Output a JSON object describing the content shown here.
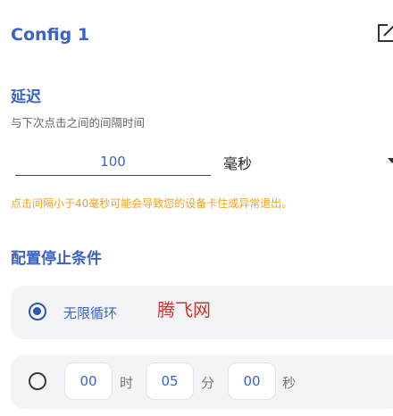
{
  "header": {
    "title": "Config 1",
    "edit_icon": "edit-icon"
  },
  "delay": {
    "title": "延迟",
    "subtitle": "与下次点击之间的间隔时间",
    "value": "100",
    "unit": "毫秒",
    "warning": "点击间隔小于40毫秒可能会导致您的设备卡住或异常退出。"
  },
  "stop_conditions": {
    "title": "配置停止条件",
    "infinite_loop": {
      "label": "无限循环",
      "selected": true
    },
    "timer": {
      "selected": false,
      "hours": "00",
      "hours_unit": "时",
      "minutes": "05",
      "minutes_unit": "分",
      "seconds": "00",
      "seconds_unit": "秒"
    }
  },
  "watermark": "腾飞网",
  "colors": {
    "accent": "#3b63c4",
    "warning": "#f0a020",
    "card_bg": "#f3f4f7",
    "watermark": "#c0392b"
  }
}
